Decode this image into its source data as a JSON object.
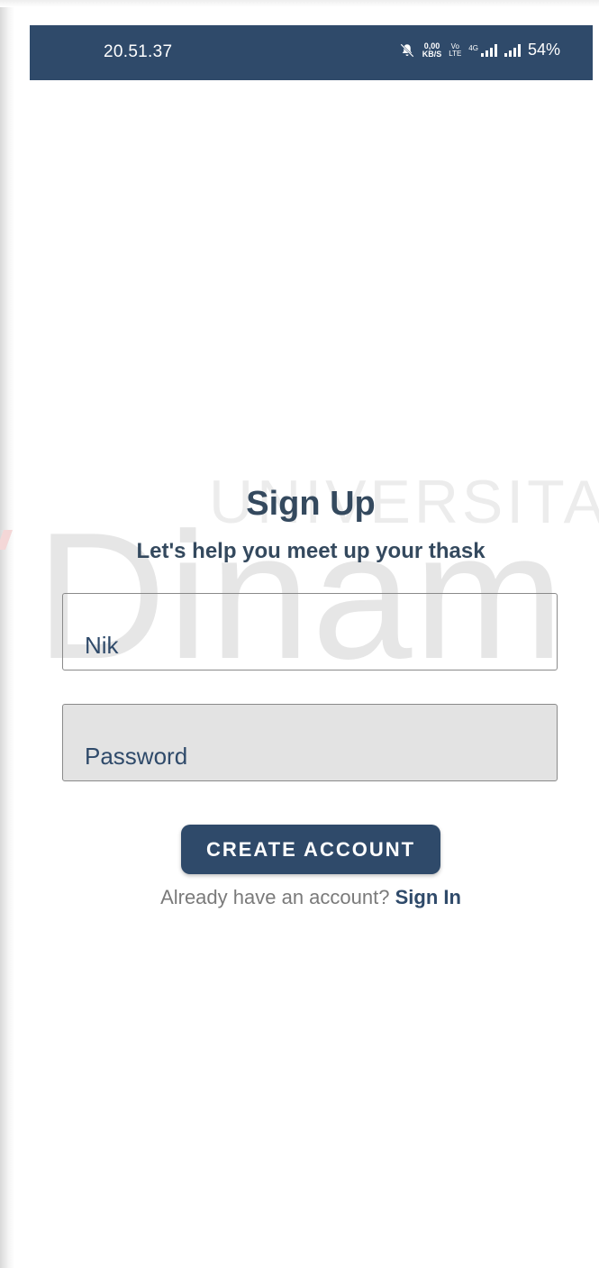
{
  "status_bar": {
    "time": "20.51.37",
    "net_speed_value": "0,00",
    "net_speed_unit": "KB/S",
    "volte_top": "Vo",
    "volte_bottom": "LTE",
    "network_type": "4G",
    "battery": "54%",
    "background_color": "#2f4a6a",
    "icons": [
      "mute-icon",
      "signal-icon",
      "signal-icon"
    ]
  },
  "watermark": {
    "line1": "UNIVERSITAS",
    "line2": "Dinam"
  },
  "form": {
    "title": "Sign Up",
    "subtitle": "Let's help you meet up your thask",
    "nik_placeholder": "Nik",
    "password_placeholder": "Password",
    "create_button_label": "CREATE ACCOUNT",
    "signin_prompt": "Already have an account?",
    "signin_link": "Sign In"
  },
  "colors": {
    "primary": "#2f4a6a",
    "title_text": "#34495e",
    "muted_text": "#7a7a7a",
    "password_field_bg": "#e3e3e3"
  }
}
